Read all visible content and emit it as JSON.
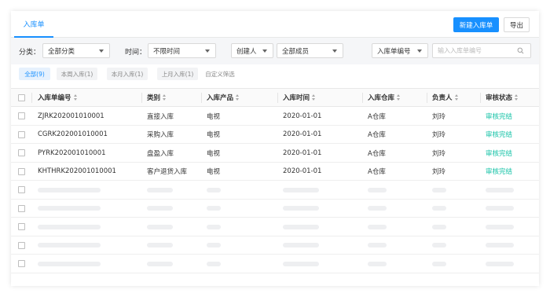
{
  "header": {
    "active_tab": "入库单",
    "new_button": "新建入库单",
    "export_button": "导出"
  },
  "filters": {
    "category_label": "分类：",
    "category_value": "全部分类",
    "time_label": "时间：",
    "time_value": "不限时间",
    "creator_select": "创建人",
    "member_value": "全部成员",
    "field_select": "入库单编号",
    "search_placeholder": "输入入库单编号"
  },
  "quick_tabs": [
    {
      "label": "全部(9)",
      "active": true
    },
    {
      "label": "本周入库(1)",
      "active": false
    },
    {
      "label": "本月入库(1)",
      "active": false
    },
    {
      "label": "上月入库(1)",
      "active": false
    },
    {
      "label": "自定义筛选",
      "active": false
    }
  ],
  "table": {
    "columns": [
      "入库单编号",
      "类别",
      "入库产品",
      "入库时间",
      "入库仓库",
      "负责人",
      "审核状态"
    ],
    "rows": [
      [
        "ZJRK202001010001",
        "直接入库",
        "电视",
        "2020-01-01",
        "A仓库",
        "刘玲",
        "审核完结"
      ],
      [
        "CGRK202001010001",
        "采购入库",
        "电视",
        "2020-01-01",
        "A仓库",
        "刘玲",
        "审核完结"
      ],
      [
        "PYRK202001010001",
        "盘盈入库",
        "电视",
        "2020-01-01",
        "A仓库",
        "刘玲",
        "审核完结"
      ],
      [
        "KHTHRK202001010001",
        "客户退货入库",
        "电视",
        "2020-01-01",
        "A仓库",
        "刘玲",
        "审核完结"
      ]
    ]
  },
  "colors": {
    "accent": "#1890ff",
    "status_ok": "#13c2a6"
  }
}
